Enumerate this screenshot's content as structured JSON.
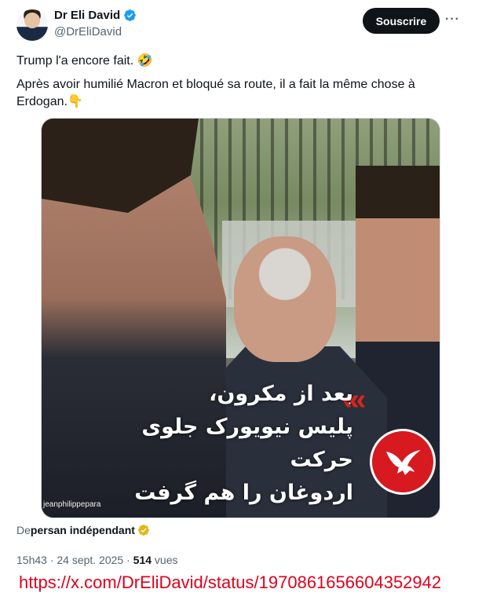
{
  "author": {
    "display_name": "Dr Eli David",
    "handle": "@DrEliDavid",
    "verified_icon": "verified-badge-icon"
  },
  "actions": {
    "subscribe_label": "Souscrire",
    "more_label": "···"
  },
  "tweet": {
    "line1": "Trump l'a encore fait. 🤣",
    "line2": "Après avoir humilié Macron et bloqué sa route, il a fait la même chose à Erdogan.👇"
  },
  "media": {
    "overlay_lines": [
      "بعد از مکرون،",
      "پلیس نیویورک جلوی حرکت",
      "اردوغان را هم گرفت"
    ],
    "watermark": "jeanphilippepara",
    "chevrons": "«"
  },
  "source": {
    "prefix": "De",
    "account": "persan indépendant"
  },
  "meta": {
    "timestamp": "15h43 · 24 sept. 2025 · ",
    "views_count": "514",
    "views_label": " vues"
  },
  "url": "https://x.com/DrEliDavid/status/1970861656604352942",
  "colors": {
    "accent_blue": "#1d9bf0",
    "gold_badge": "#e2b719",
    "url_red": "#e0001b",
    "logo_red": "#d71920"
  }
}
